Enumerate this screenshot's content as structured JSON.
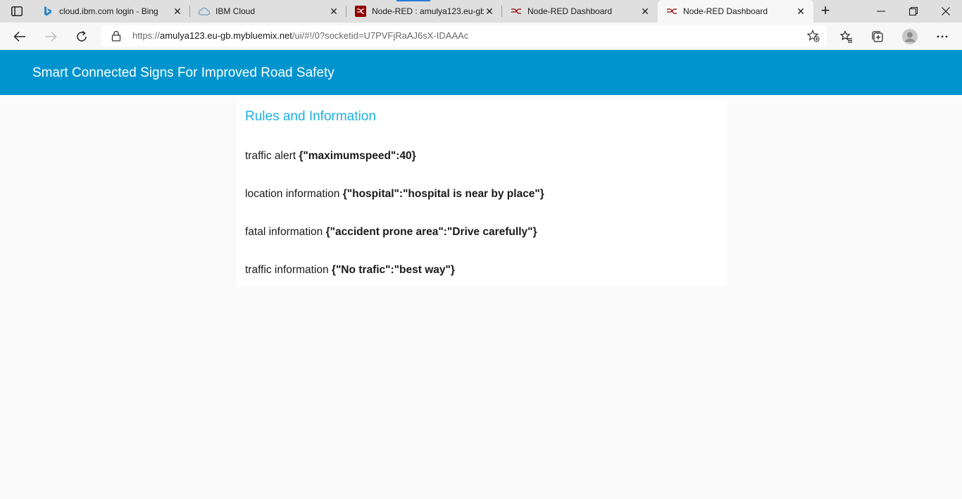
{
  "browser": {
    "tabs": [
      {
        "title": "cloud.ibm.com login - Bing",
        "icon": "bing-icon"
      },
      {
        "title": "IBM Cloud",
        "icon": "cloud-icon"
      },
      {
        "title": "Node-RED : amulya123.eu-gb",
        "icon": "node-red-icon"
      },
      {
        "title": "Node-RED Dashboard",
        "icon": "node-red-icon"
      },
      {
        "title": "Node-RED Dashboard",
        "icon": "node-red-icon"
      }
    ],
    "active_tab_index": 4,
    "url_prefix": "https://",
    "url_host": "amulya123.eu-gb.mybluemix.net",
    "url_path": "/ui/#!/0?socketid=U7PVFjRaAJ6sX-IDAAAc"
  },
  "app": {
    "title": "Smart Connected Signs For Improved Road Safety",
    "header_color": "#0094ce"
  },
  "card": {
    "title": "Rules and Information",
    "title_color": "#1bb2e6",
    "rows": [
      {
        "label": "traffic alert",
        "value": "{\"maximumspeed\":40}"
      },
      {
        "label": "location information",
        "value": "{\"hospital\":\"hospital is near by place\"}"
      },
      {
        "label": "fatal information",
        "value": "{\"accident prone area\":\"Drive carefully\"}"
      },
      {
        "label": "traffic information",
        "value": "{\"No trafic\":\"best way\"}"
      }
    ]
  }
}
